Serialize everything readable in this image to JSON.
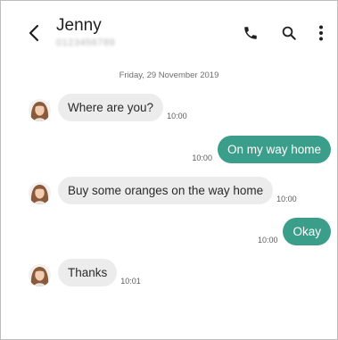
{
  "header": {
    "contact_name": "Jenny",
    "contact_number": "0123456789"
  },
  "icons": {
    "back": "chevron-left-icon",
    "call": "phone-icon",
    "search": "search-icon",
    "more": "more-vertical-icon"
  },
  "colors": {
    "incoming_bubble": "#ececec",
    "outgoing_bubble": "#3a9e8a"
  },
  "conversation": {
    "date": "Friday, 29 November 2019",
    "messages": [
      {
        "direction": "incoming",
        "text": "Where are you?",
        "time": "10:00"
      },
      {
        "direction": "outgoing",
        "text": "On my way home",
        "time": "10:00"
      },
      {
        "direction": "incoming",
        "text": "Buy some oranges on the way home",
        "time": "10:00"
      },
      {
        "direction": "outgoing",
        "text": "Okay",
        "time": "10:00"
      },
      {
        "direction": "incoming",
        "text": "Thanks",
        "time": "10:01"
      }
    ]
  }
}
